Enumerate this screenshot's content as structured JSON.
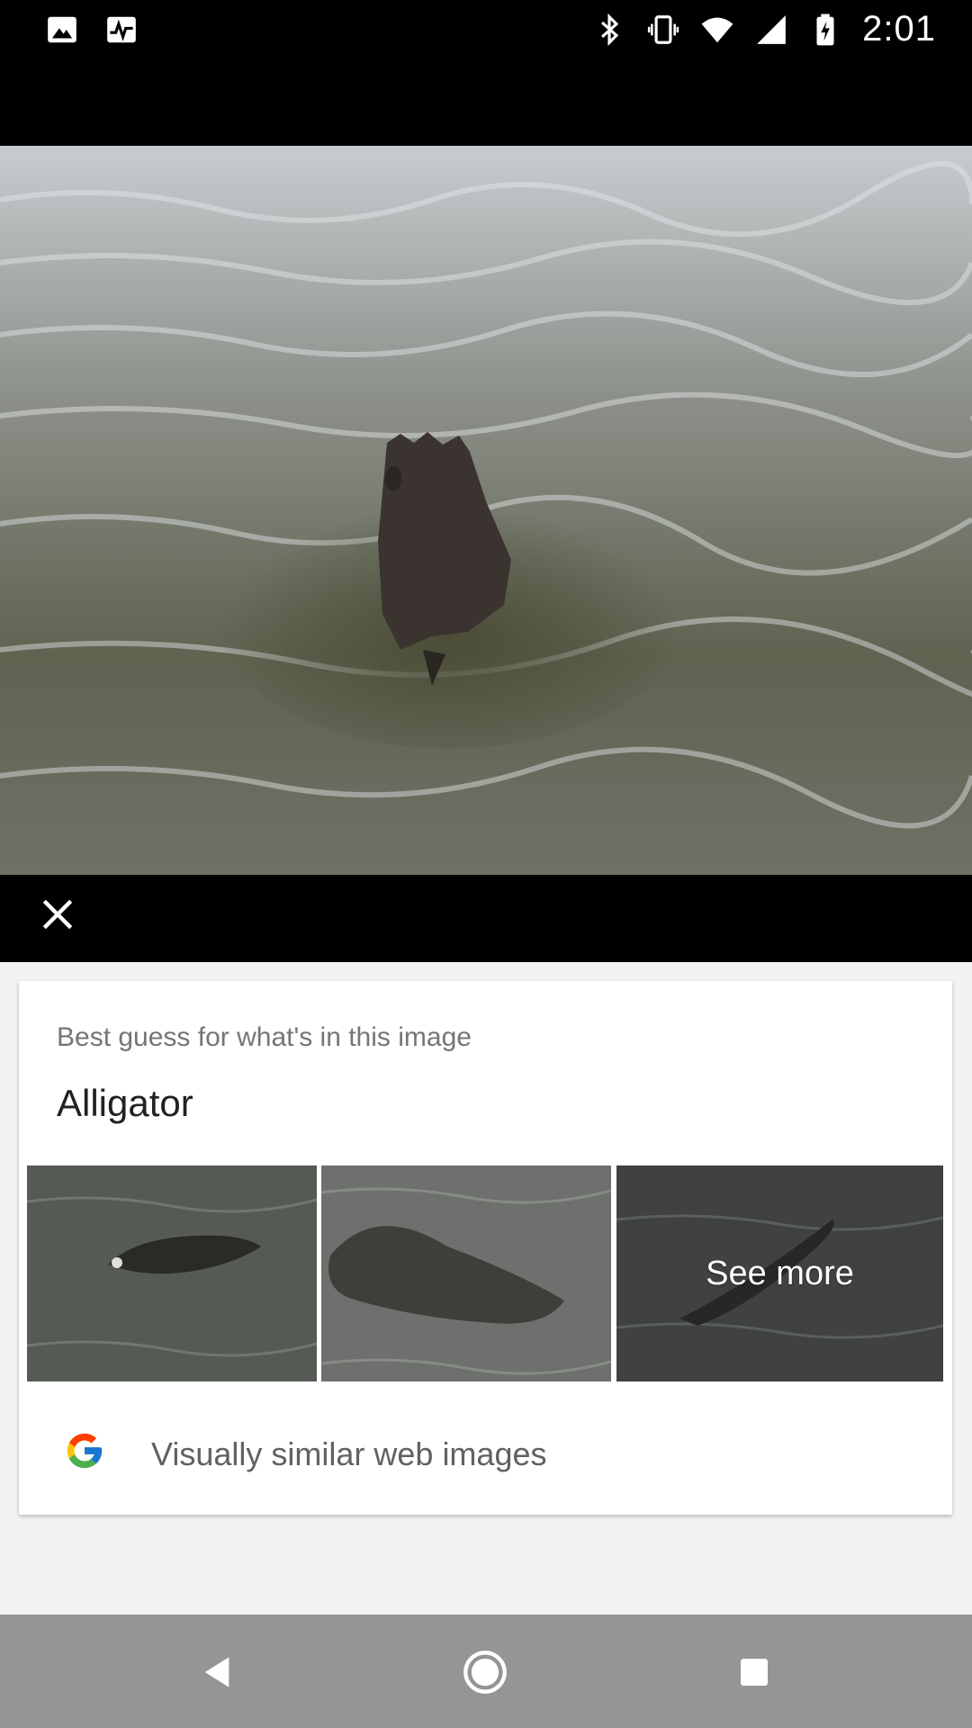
{
  "status_bar": {
    "time": "2:01",
    "left_icons": [
      "image-notification-icon",
      "activity-notification-icon"
    ],
    "right_icons": [
      "bluetooth-icon",
      "vibrate-icon",
      "wifi-icon",
      "cellular-signal-icon",
      "battery-charging-icon"
    ]
  },
  "viewer": {
    "close_icon": "close-icon"
  },
  "result_card": {
    "caption": "Best guess for what's in this image",
    "title": "Alligator",
    "thumbnails": [
      {
        "label": ""
      },
      {
        "label": ""
      },
      {
        "label": "See more"
      }
    ],
    "similar_images_label": "Visually similar web images",
    "logo": "google-g-logo"
  },
  "nav_bar": {
    "buttons": [
      "back-icon",
      "home-icon",
      "recents-icon"
    ]
  },
  "colors": {
    "status_bar_bg": "#000000",
    "card_bg": "#ffffff",
    "page_bg": "#f2f2f2",
    "nav_bar_bg": "#959595"
  }
}
